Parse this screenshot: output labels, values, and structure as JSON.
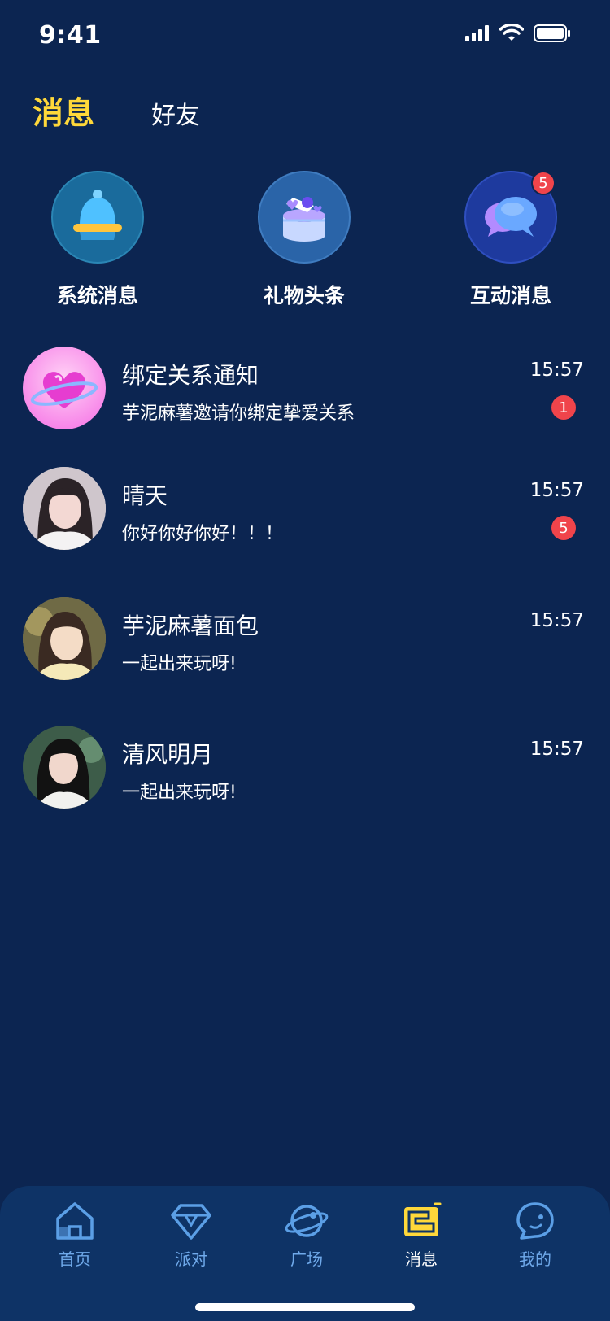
{
  "status": {
    "time": "9:41"
  },
  "tabs": {
    "messages": "消息",
    "friends": "好友"
  },
  "shortcuts": [
    {
      "label": "系统消息",
      "icon": "bell-icon"
    },
    {
      "label": "礼物头条",
      "icon": "gift-box-icon"
    },
    {
      "label": "互动消息",
      "icon": "chat-bubbles-icon",
      "badge": "5"
    }
  ],
  "chats": [
    {
      "name": "绑定关系通知",
      "preview": "芋泥麻薯邀请你绑定挚爱关系",
      "time": "15:57",
      "unread": "1",
      "avatar": "heart-planet-icon"
    },
    {
      "name": "晴天",
      "preview": "你好你好你好！！！",
      "time": "15:57",
      "unread": "5",
      "avatar": "user-avatar"
    },
    {
      "name": "芋泥麻薯面包",
      "preview": "一起出来玩呀!",
      "time": "15:57",
      "avatar": "user-avatar"
    },
    {
      "name": "清风明月",
      "preview": "一起出来玩呀!",
      "time": "15:57",
      "avatar": "user-avatar"
    }
  ],
  "tabbar": [
    {
      "label": "首页",
      "icon": "home-icon"
    },
    {
      "label": "派对",
      "icon": "party-diamond-icon"
    },
    {
      "label": "广场",
      "icon": "planet-icon"
    },
    {
      "label": "消息",
      "icon": "message-icon",
      "active": true
    },
    {
      "label": "我的",
      "icon": "profile-bubble-icon"
    }
  ],
  "colors": {
    "background": "#0c2551",
    "accent": "#ffd83a",
    "badge": "#f0444b",
    "tab_inactive": "#6fa9ea"
  }
}
